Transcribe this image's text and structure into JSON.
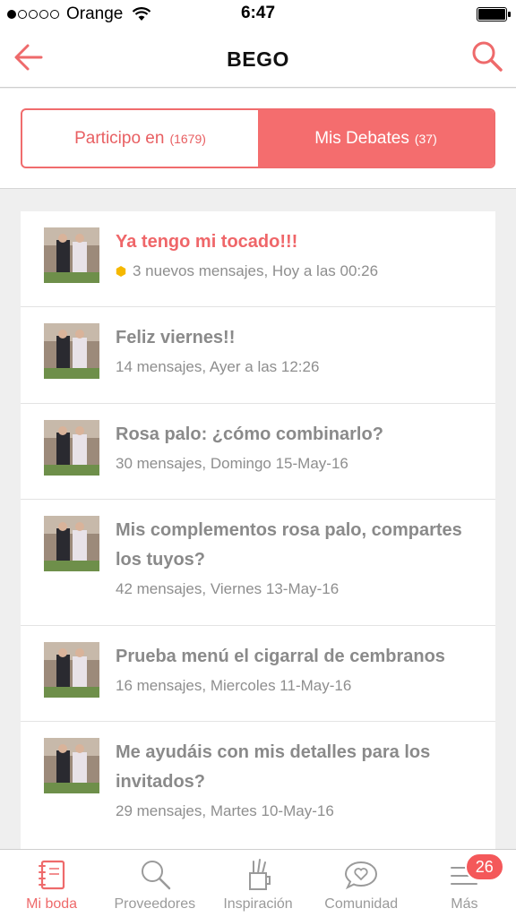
{
  "status_bar": {
    "carrier": "Orange",
    "time": "6:47",
    "signal_bars_filled": 1,
    "signal_bars_total": 5
  },
  "header": {
    "title": "BEGO",
    "back_icon": "arrow-left-icon",
    "search_icon": "search-icon"
  },
  "segments": [
    {
      "label": "Participo en",
      "count": "(1679)",
      "active": false
    },
    {
      "label": "Mis Debates",
      "count": "(37)",
      "active": true
    }
  ],
  "threads": [
    {
      "title": "Ya tengo mi tocado!!!",
      "meta": "3 nuevos mensajes, Hoy a las 00:26",
      "unread": true
    },
    {
      "title": "Feliz viernes!!",
      "meta": "14 mensajes, Ayer a las 12:26",
      "unread": false
    },
    {
      "title": "Rosa palo: ¿cómo combinarlo?",
      "meta": "30 mensajes, Domingo 15-May-16",
      "unread": false
    },
    {
      "title": "Mis complementos rosa palo, compartes los tuyos?",
      "meta": "42 mensajes, Viernes 13-May-16",
      "unread": false
    },
    {
      "title": "Prueba menú el cigarral de cembranos",
      "meta": "16 mensajes, Miercoles 11-May-16",
      "unread": false
    },
    {
      "title": "Me ayudáis con mis detalles para los invitados?",
      "meta": "29 mensajes, Martes 10-May-16",
      "unread": false
    }
  ],
  "tabbar": [
    {
      "label": "Mi boda",
      "icon": "notebook-icon",
      "active": true
    },
    {
      "label": "Proveedores",
      "icon": "search-icon",
      "active": false
    },
    {
      "label": "Inspiración",
      "icon": "pencil-cup-icon",
      "active": false
    },
    {
      "label": "Comunidad",
      "icon": "heart-bubble-icon",
      "active": false
    },
    {
      "label": "Más",
      "icon": "menu-icon",
      "active": false,
      "badge": "26"
    }
  ],
  "colors": {
    "accent": "#f46d6e",
    "unread_dot": "#f5b800",
    "muted_text": "#8a8a8a"
  }
}
